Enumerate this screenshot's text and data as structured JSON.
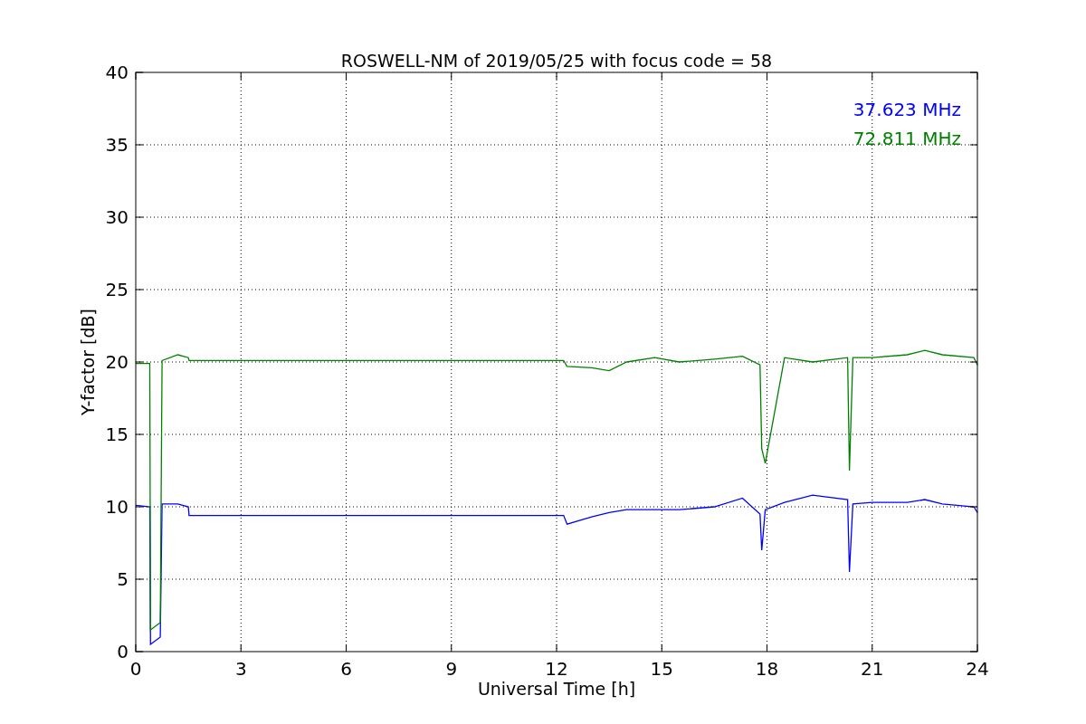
{
  "figure": {
    "chart_data": {
      "type": "line",
      "title": "ROSWELL-NM of 2019/05/25 with focus code = 58",
      "xlabel": "Universal Time [h]",
      "ylabel": "Y-factor [dB]",
      "x": [
        0,
        0.4,
        0.42,
        0.7,
        0.75,
        1.2,
        1.5,
        1.52,
        12.2,
        12.3,
        13,
        13.5,
        14,
        14.8,
        15.5,
        16.5,
        17.3,
        17.8,
        17.85,
        17.95,
        18.5,
        19.3,
        20.3,
        20.35,
        20.45,
        21,
        22,
        22.5,
        23,
        23.9,
        24
      ],
      "series": [
        {
          "name": "37.623 MHz",
          "color": "#0000ff",
          "values": [
            10.1,
            10,
            0.5,
            1,
            10.2,
            10.2,
            10,
            9.4,
            9.4,
            8.8,
            9.3,
            9.6,
            9.8,
            9.8,
            9.8,
            10,
            10.6,
            9.5,
            7,
            9.8,
            10.3,
            10.8,
            10.5,
            5.5,
            10.2,
            10.3,
            10.3,
            10.5,
            10.2,
            10,
            9.6
          ]
        },
        {
          "name": "72.811 MHz",
          "color": "#008000",
          "values": [
            19.9,
            19.9,
            1.5,
            2,
            20.1,
            20.5,
            20.3,
            20.1,
            20.1,
            19.7,
            19.6,
            19.4,
            20,
            20.3,
            20,
            20.2,
            20.4,
            19.8,
            14,
            13,
            20.3,
            20,
            20.3,
            12.5,
            20.3,
            20.3,
            20.5,
            20.8,
            20.5,
            20.3,
            19.8
          ]
        }
      ],
      "xlim": [
        0,
        24
      ],
      "ylim": [
        0,
        40
      ],
      "xticks": [
        0,
        3,
        6,
        9,
        12,
        15,
        18,
        21,
        24
      ],
      "yticks": [
        0,
        5,
        10,
        15,
        20,
        25,
        30,
        35,
        40
      ],
      "grid": true
    }
  }
}
